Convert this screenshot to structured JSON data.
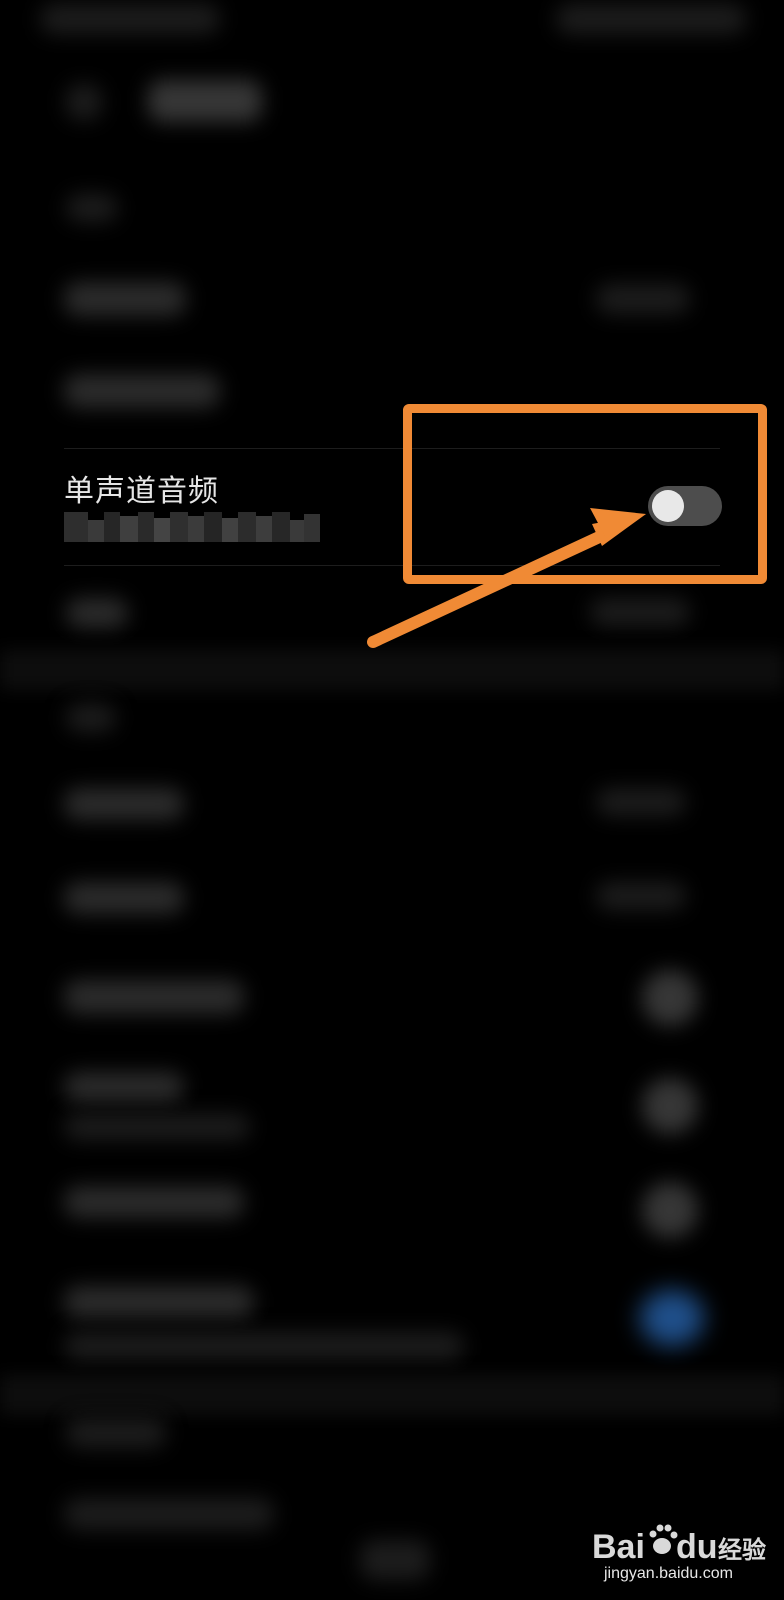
{
  "setting_row": {
    "title": "单声道音频",
    "subtitle_redacted": true,
    "toggle_state": "off"
  },
  "annotation": {
    "color": "#f08a35"
  },
  "watermark": {
    "url": "jingyan.baidu.com"
  },
  "colors": {
    "background": "#000000",
    "toggle_track_off": "#4d4d4d",
    "toggle_knob": "#e8e8e8",
    "title_text": "#e6e6e6"
  }
}
